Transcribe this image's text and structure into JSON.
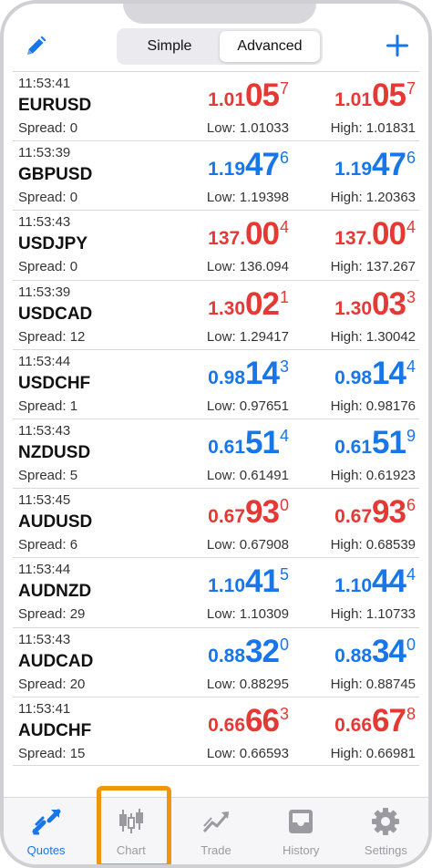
{
  "header": {
    "segments": [
      "Simple",
      "Advanced"
    ],
    "active_segment": "Advanced",
    "edit_icon": "pencil-icon",
    "add_icon": "plus-icon"
  },
  "colors": {
    "up": "#1976e8",
    "down": "#e53935",
    "accent": "#1976e8",
    "highlight": "#f0960c"
  },
  "quotes": [
    {
      "time": "11:53:41",
      "symbol": "EURUSD",
      "spread": "Spread: 0",
      "color": "red",
      "bid": {
        "small": "1.01",
        "big": "05",
        "sup": "7"
      },
      "ask": {
        "small": "1.01",
        "big": "05",
        "sup": "7"
      },
      "low": "Low: 1.01033",
      "high": "High: 1.01831"
    },
    {
      "time": "11:53:39",
      "symbol": "GBPUSD",
      "spread": "Spread: 0",
      "color": "blue",
      "bid": {
        "small": "1.19",
        "big": "47",
        "sup": "6"
      },
      "ask": {
        "small": "1.19",
        "big": "47",
        "sup": "6"
      },
      "low": "Low: 1.19398",
      "high": "High: 1.20363"
    },
    {
      "time": "11:53:43",
      "symbol": "USDJPY",
      "spread": "Spread: 0",
      "color": "red",
      "bid": {
        "small": "137.",
        "big": "00",
        "sup": "4"
      },
      "ask": {
        "small": "137.",
        "big": "00",
        "sup": "4"
      },
      "low": "Low: 136.094",
      "high": "High: 137.267"
    },
    {
      "time": "11:53:39",
      "symbol": "USDCAD",
      "spread": "Spread: 12",
      "color": "red",
      "bid": {
        "small": "1.30",
        "big": "02",
        "sup": "1"
      },
      "ask": {
        "small": "1.30",
        "big": "03",
        "sup": "3"
      },
      "low": "Low: 1.29417",
      "high": "High: 1.30042"
    },
    {
      "time": "11:53:44",
      "symbol": "USDCHF",
      "spread": "Spread: 1",
      "color": "blue",
      "bid": {
        "small": "0.98",
        "big": "14",
        "sup": "3"
      },
      "ask": {
        "small": "0.98",
        "big": "14",
        "sup": "4"
      },
      "low": "Low: 0.97651",
      "high": "High: 0.98176"
    },
    {
      "time": "11:53:43",
      "symbol": "NZDUSD",
      "spread": "Spread: 5",
      "color": "blue",
      "bid": {
        "small": "0.61",
        "big": "51",
        "sup": "4"
      },
      "ask": {
        "small": "0.61",
        "big": "51",
        "sup": "9"
      },
      "low": "Low: 0.61491",
      "high": "High: 0.61923"
    },
    {
      "time": "11:53:45",
      "symbol": "AUDUSD",
      "spread": "Spread: 6",
      "color": "red",
      "bid": {
        "small": "0.67",
        "big": "93",
        "sup": "0"
      },
      "ask": {
        "small": "0.67",
        "big": "93",
        "sup": "6"
      },
      "low": "Low: 0.67908",
      "high": "High: 0.68539"
    },
    {
      "time": "11:53:44",
      "symbol": "AUDNZD",
      "spread": "Spread: 29",
      "color": "blue",
      "bid": {
        "small": "1.10",
        "big": "41",
        "sup": "5"
      },
      "ask": {
        "small": "1.10",
        "big": "44",
        "sup": "4"
      },
      "low": "Low: 1.10309",
      "high": "High: 1.10733"
    },
    {
      "time": "11:53:43",
      "symbol": "AUDCAD",
      "spread": "Spread: 20",
      "color": "blue",
      "bid": {
        "small": "0.88",
        "big": "32",
        "sup": "0"
      },
      "ask": {
        "small": "0.88",
        "big": "34",
        "sup": "0"
      },
      "low": "Low: 0.88295",
      "high": "High: 0.88745"
    },
    {
      "time": "11:53:41",
      "symbol": "AUDCHF",
      "spread": "Spread: 15",
      "color": "red",
      "bid": {
        "small": "0.66",
        "big": "66",
        "sup": "3"
      },
      "ask": {
        "small": "0.66",
        "big": "67",
        "sup": "8"
      },
      "low": "Low: 0.66593",
      "high": "High: 0.66981"
    }
  ],
  "tabs": [
    {
      "label": "Quotes",
      "icon": "quotes-arrows-icon",
      "active": true
    },
    {
      "label": "Chart",
      "icon": "candlestick-chart-icon",
      "active": false,
      "highlighted": true
    },
    {
      "label": "Trade",
      "icon": "trade-line-chart-icon",
      "active": false
    },
    {
      "label": "History",
      "icon": "history-inbox-icon",
      "active": false
    },
    {
      "label": "Settings",
      "icon": "gear-icon",
      "active": false
    }
  ]
}
